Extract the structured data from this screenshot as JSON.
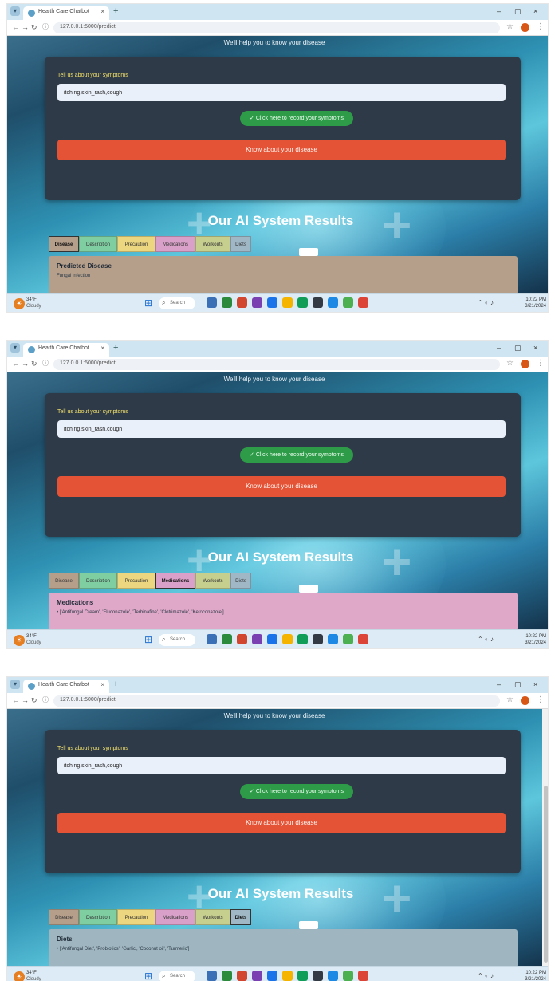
{
  "browser": {
    "tab_title": "Health Care Chatbot",
    "address": "127.0.0.1:5000/predict"
  },
  "page": {
    "subtitle": "We'll help you to know your disease",
    "symptoms_label": "Tell us about your symptoms",
    "symptoms_value": "itching,skin_rash,cough",
    "record_label": "✓ Click here to record your symptoms",
    "submit_label": "Know about your disease",
    "results_title": "Our AI System Results",
    "tabs": [
      "Disease",
      "Description",
      "Precaution",
      "Medications",
      "Workouts",
      "Diets"
    ]
  },
  "screenshots": [
    {
      "active_tab": "Disease",
      "panel_title": "Predicted Disease",
      "panel_text": "Fungal infection",
      "panel_color": "#b59e8a"
    },
    {
      "active_tab": "Medications",
      "panel_title": "Medications",
      "panel_text": "• ['Antifungal Cream', 'Fluconazole', 'Terbinafine', 'Clotrimazole', 'Ketoconazole']",
      "panel_color": "#dfa7c8"
    },
    {
      "active_tab": "Diets",
      "panel_title": "Diets",
      "panel_text": "• ['Antifungal Diet', 'Probiotics', 'Garlic', 'Coconut oil', 'Turmeric']",
      "panel_color": "#9fb5bf"
    }
  ],
  "taskbar": {
    "weather_temp": "34°F",
    "weather_desc": "Cloudy",
    "search_text": "Search",
    "clock_time": "10:22 PM",
    "clock_date": "3/21/2024"
  },
  "colors": {
    "card": "#2e3a48",
    "record_button": "#2e9b49",
    "submit_button": "#e45336",
    "label": "#f2e06a"
  }
}
